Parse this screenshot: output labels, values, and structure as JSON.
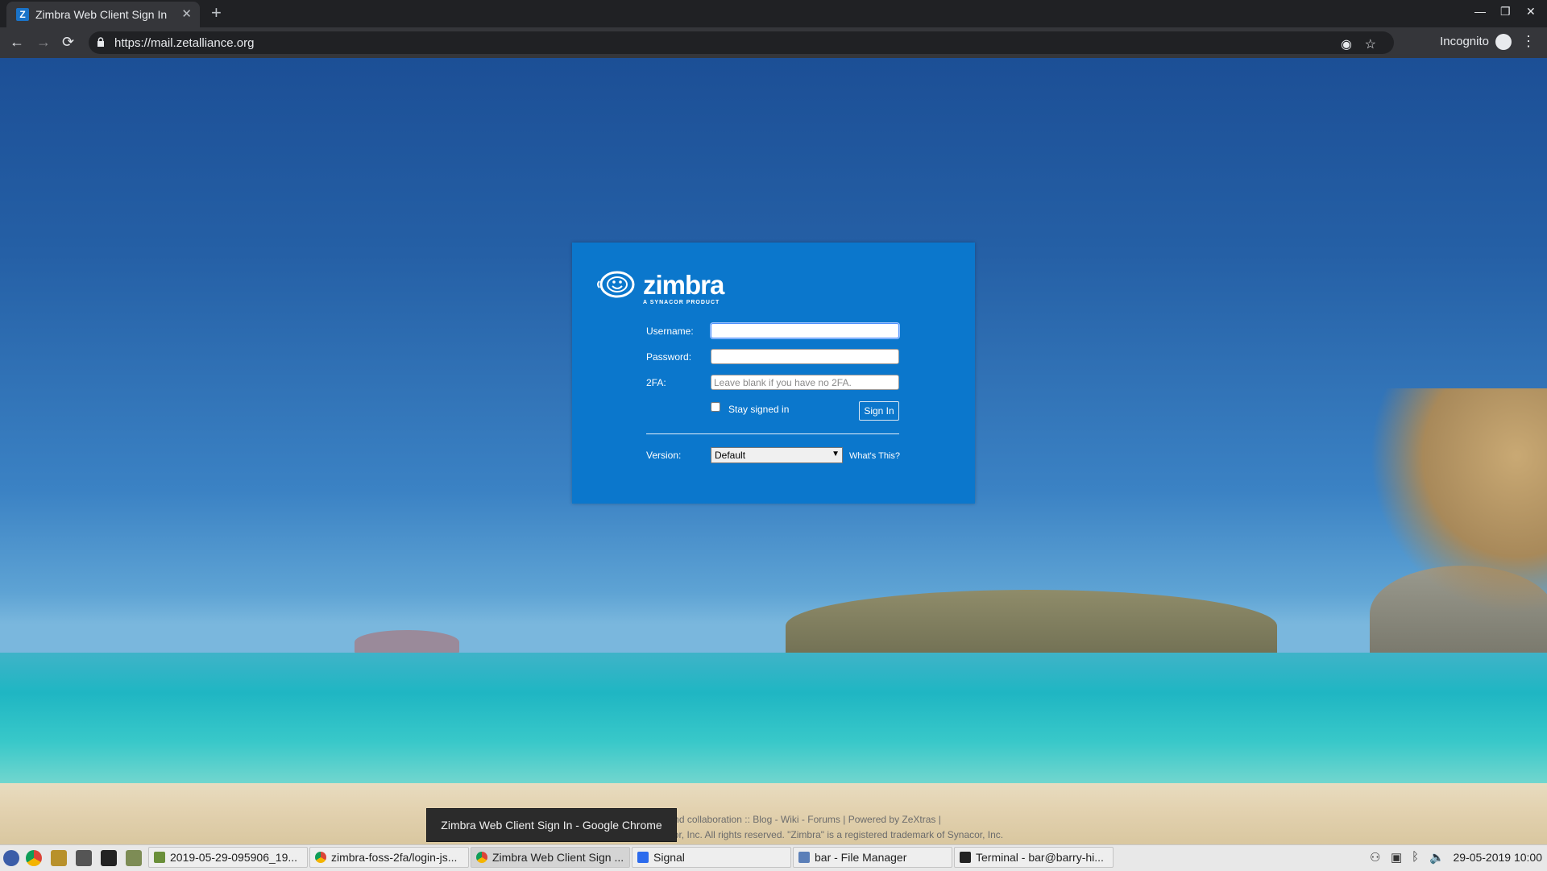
{
  "browser": {
    "tab_title": "Zimbra Web Client Sign In",
    "tab_favicon": "Z",
    "url": "https://mail.zetalliance.org",
    "incognito_label": "Incognito",
    "new_tab_symbol": "+",
    "close_symbol": "✕"
  },
  "login": {
    "logo_wordmark": "zimbra",
    "logo_tagline": "A SYNACOR PRODUCT",
    "username_label": "Username:",
    "username_value": "",
    "password_label": "Password:",
    "password_value": "",
    "twofa_label": "2FA:",
    "twofa_placeholder": "Leave blank if you have no 2FA.",
    "stay_signed_in_label": "Stay signed in",
    "stay_signed_in_checked": false,
    "sign_in_label": "Sign In",
    "version_label": "Version:",
    "version_value": "Default",
    "whats_this_label": "What's This?"
  },
  "footer": {
    "line1": "ce messaging and collaboration :: Blog - Wiki - Forums | Powered by ZeXtras |",
    "line2": "Copyright © 2005-2017 Synacor, Inc. All rights reserved. \"Zimbra\" is a registered trademark of Synacor, Inc."
  },
  "tooltip": "Zimbra Web Client Sign In - Google Chrome",
  "taskbar": {
    "tasks": [
      {
        "label": "2019-05-29-095906_19..."
      },
      {
        "label": "zimbra-foss-2fa/login-js..."
      },
      {
        "label": "Zimbra Web Client Sign ..."
      },
      {
        "label": "Signal"
      },
      {
        "label": "bar - File Manager"
      },
      {
        "label": "Terminal - bar@barry-hi..."
      }
    ],
    "clock": "29-05-2019 10:00"
  },
  "colors": {
    "login_panel": "#0b77cc",
    "chrome_dark": "#202124",
    "chrome_toolbar": "#35363a"
  }
}
